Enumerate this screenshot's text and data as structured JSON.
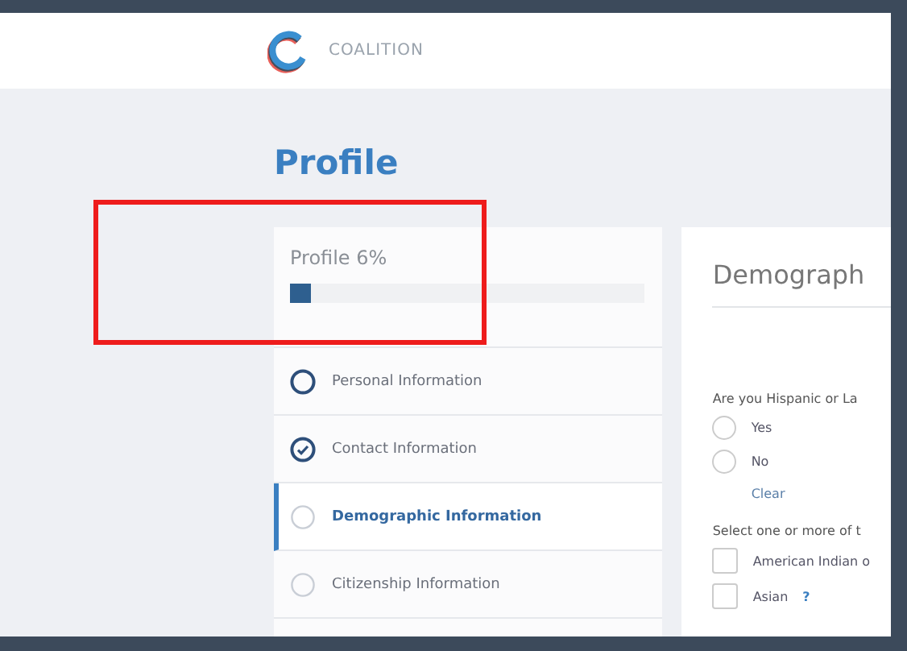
{
  "header": {
    "brand": "COALITION"
  },
  "page_title": "Profile",
  "progress": {
    "label": "Profile 6%",
    "level": 0.06
  },
  "sections": [
    {
      "label": "Personal Information",
      "checked": false,
      "active": true,
      "selected": false
    },
    {
      "label": "Contact Information",
      "checked": true,
      "active": true,
      "selected": false
    },
    {
      "label": "Demographic Information",
      "checked": false,
      "active": false,
      "selected": true
    },
    {
      "label": "Citizenship Information",
      "checked": false,
      "active": false,
      "selected": false
    }
  ],
  "form": {
    "heading": "Demograph",
    "question": "Are you Hispanic or La",
    "options": [
      {
        "label": "Yes",
        "selected": false
      },
      {
        "label": "No",
        "selected": false
      }
    ],
    "clear": "Clear",
    "select_prompt": "Select one or more of t",
    "checkboxes": [
      {
        "label": "American Indian o",
        "checked": false
      },
      {
        "label": "Asian",
        "checked": false,
        "help": "?"
      }
    ]
  },
  "highlight": true
}
